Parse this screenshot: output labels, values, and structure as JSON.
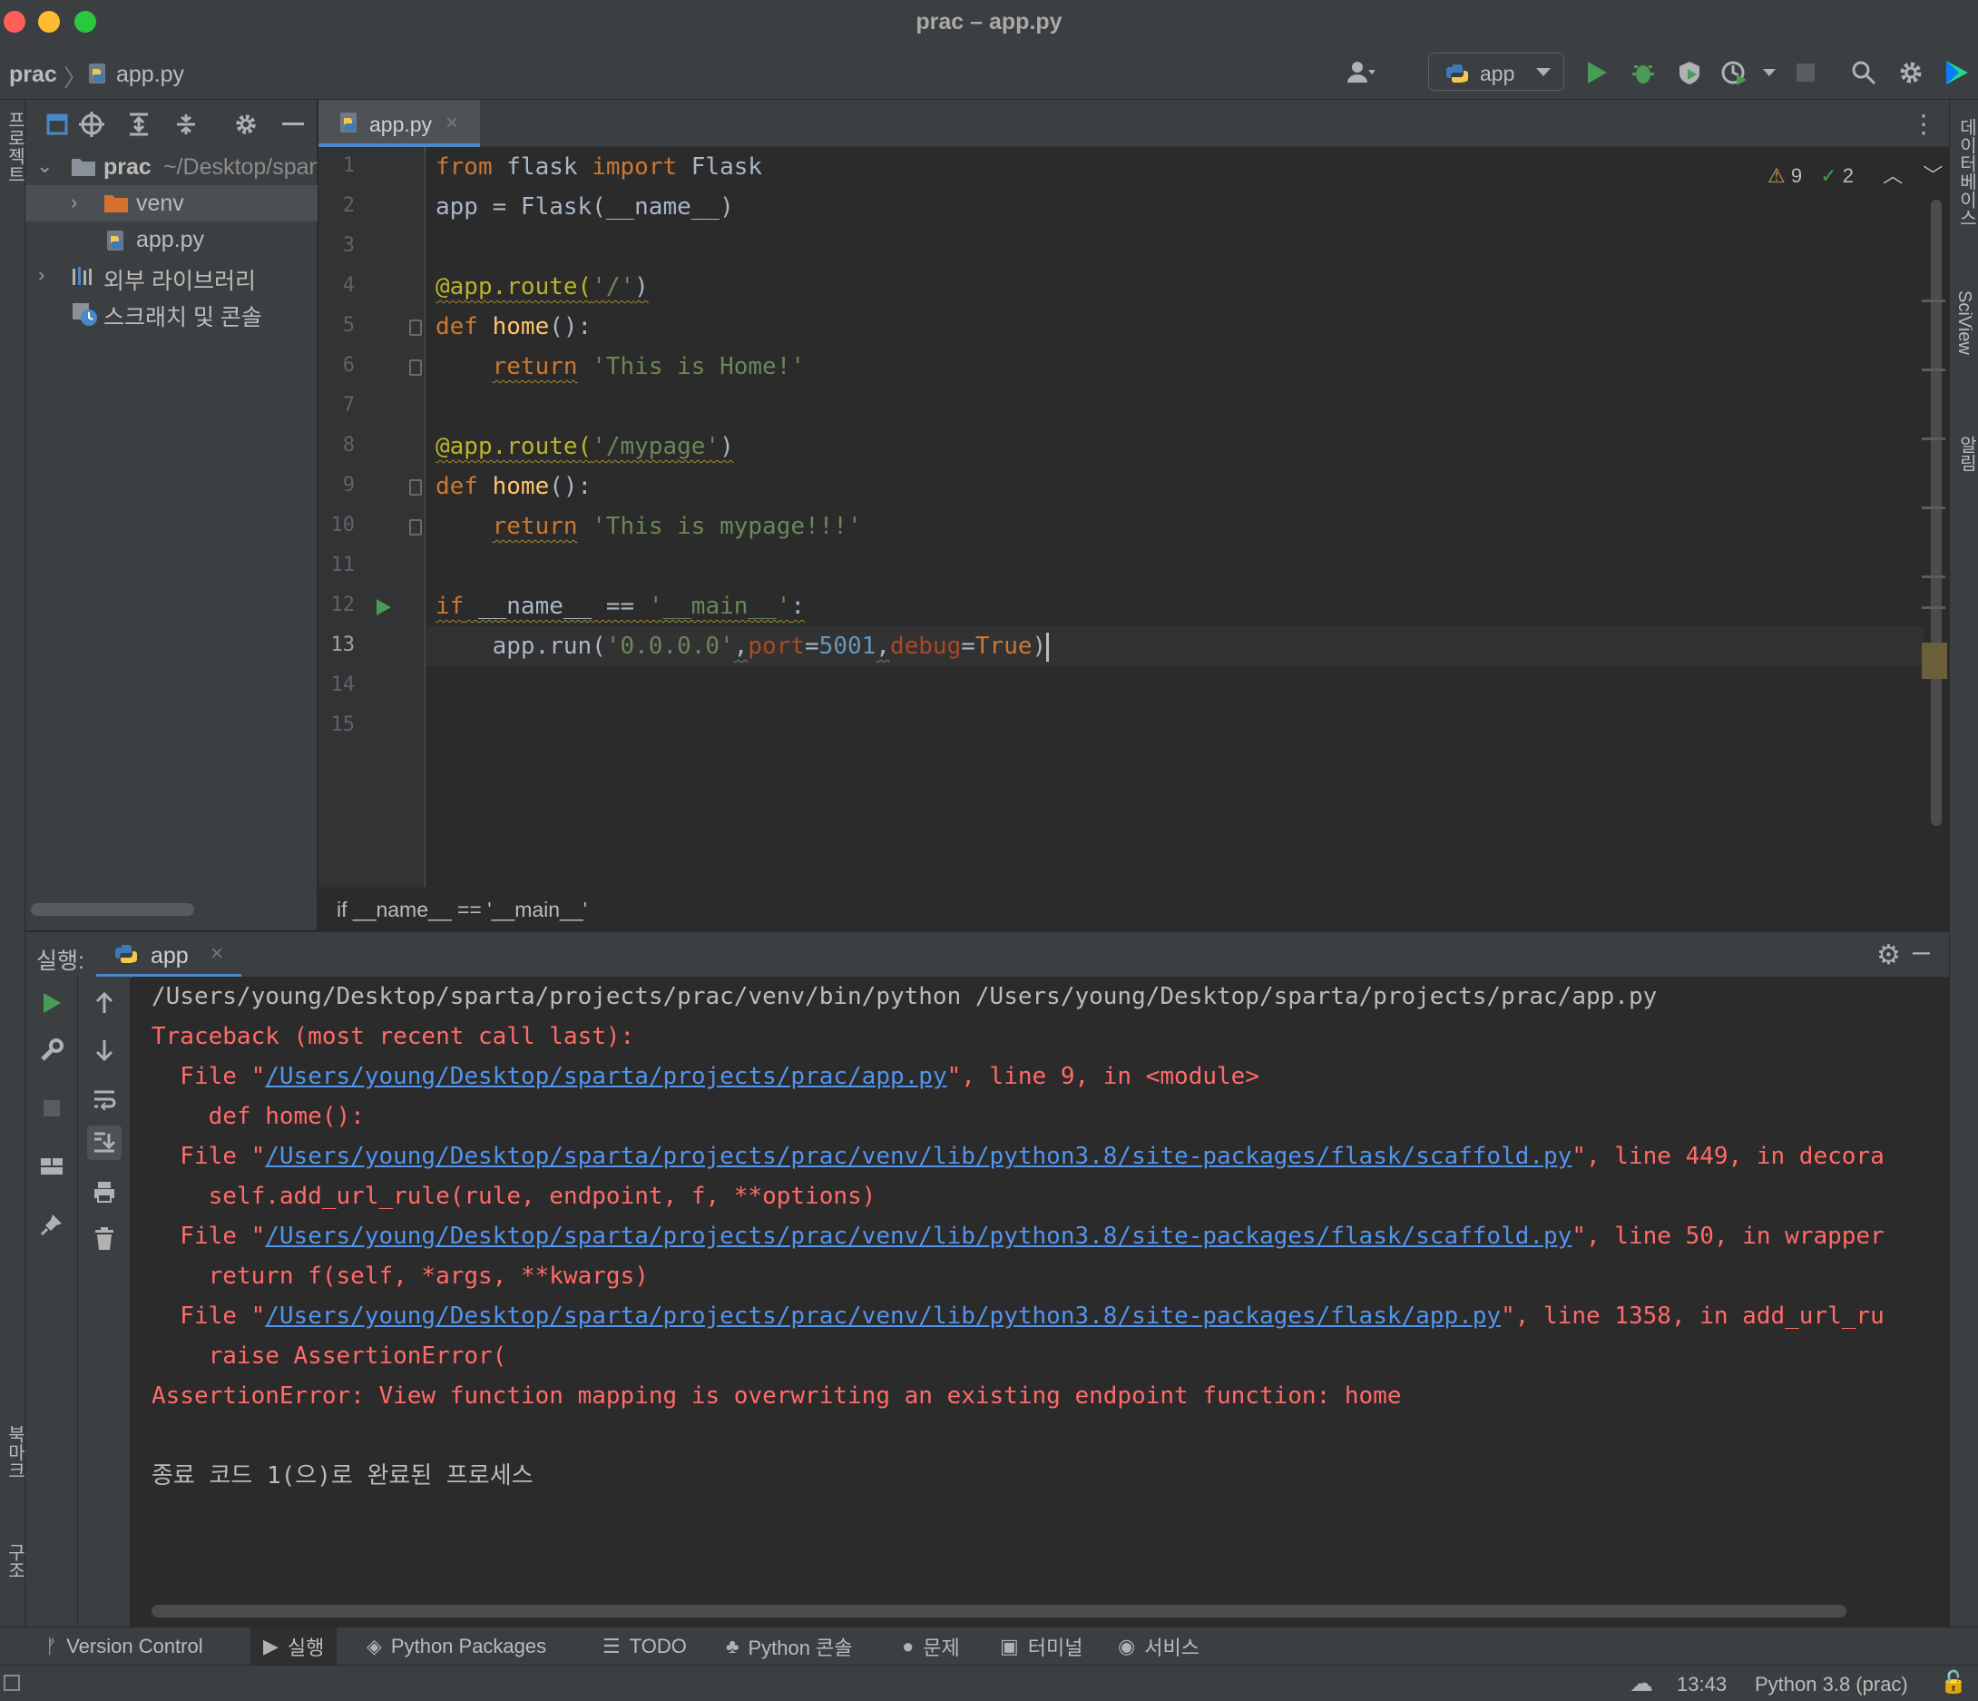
{
  "window": {
    "title": "prac – app.py"
  },
  "navbar": {
    "project": "prac",
    "file": "app.py",
    "run_config": "app"
  },
  "left_stripe": {
    "project_label": "프로젝트",
    "bookmarks_label": "북마크",
    "structure_label": "구조"
  },
  "right_stripe": {
    "database_label": "데이터베이스",
    "sciview_label": "SciView",
    "notifications_label": "알림"
  },
  "project_tree": {
    "root_name": "prac",
    "root_path": "~/Desktop/sparta/projects/prac",
    "items": [
      {
        "label": "venv",
        "type": "folder"
      },
      {
        "label": "app.py",
        "type": "python-file"
      },
      {
        "label": "외부 라이브러리",
        "type": "libraries"
      },
      {
        "label": "스크래치 및 콘솔",
        "type": "scratches"
      }
    ]
  },
  "editor": {
    "tab_label": "app.py",
    "warnings_count": "9",
    "weak_warnings_count": "2",
    "current_line": 13,
    "line_numbers": [
      "1",
      "2",
      "3",
      "4",
      "5",
      "6",
      "7",
      "8",
      "9",
      "10",
      "11",
      "12",
      "13",
      "14",
      "15"
    ],
    "lines": {
      "l1": {
        "a": "from",
        "b": " flask ",
        "c": "import",
        "d": " Flask"
      },
      "l2": {
        "a": "app = Flask(__name__)"
      },
      "l4": {
        "a": "@app.route(",
        "b": "'/'",
        "c": ")"
      },
      "l5": {
        "a": "def",
        "b": " ",
        "c": "home",
        "d": "():"
      },
      "l6": {
        "a": "    ",
        "b": "return",
        "c": " ",
        "d": "'This is Home!'"
      },
      "l8": {
        "a": "@app.route(",
        "b": "'/mypage'",
        "c": ")"
      },
      "l9": {
        "a": "def",
        "b": " ",
        "c": "home",
        "d": "():"
      },
      "l10": {
        "a": "    ",
        "b": "return",
        "c": " ",
        "d": "'This is mypage!!!'"
      },
      "l12": {
        "a": "if",
        "b": " ",
        "c": "__name__",
        "d": " == ",
        "e": "'__main__'",
        "f": ":"
      },
      "l13": {
        "a": "    app.run(",
        "b": "'0.0.0.0'",
        "c": ",",
        "d": "port",
        "e": "=",
        "f": "5001",
        "g": ",",
        "h": "debug",
        "i": "=",
        "j": "True",
        "k": ")"
      }
    },
    "breadcrumb": "if __name__ == '__main__'"
  },
  "run_panel": {
    "title": "실행:",
    "tab_label": "app",
    "console": {
      "cmd": "/Users/young/Desktop/sparta/projects/prac/venv/bin/python /Users/young/Desktop/sparta/projects/prac/app.py",
      "traceback_header": "Traceback (most recent call last):",
      "frames": [
        {
          "prefix": "  File \"",
          "path": "/Users/young/Desktop/sparta/projects/prac/app.py",
          "suffix": "\", line 9, in <module>",
          "code": "    def home():"
        },
        {
          "prefix": "  File \"",
          "path": "/Users/young/Desktop/sparta/projects/prac/venv/lib/python3.8/site-packages/flask/scaffold.py",
          "suffix": "\", line 449, in decora",
          "code": "    self.add_url_rule(rule, endpoint, f, **options)"
        },
        {
          "prefix": "  File \"",
          "path": "/Users/young/Desktop/sparta/projects/prac/venv/lib/python3.8/site-packages/flask/scaffold.py",
          "suffix": "\", line 50, in wrapper",
          "code": "    return f(self, *args, **kwargs)"
        },
        {
          "prefix": "  File \"",
          "path": "/Users/young/Desktop/sparta/projects/prac/venv/lib/python3.8/site-packages/flask/app.py",
          "suffix": "\", line 1358, in add_url_ru",
          "code": "    raise AssertionError("
        }
      ],
      "error": "AssertionError: View function mapping is overwriting an existing endpoint function: home",
      "exit": "종료 코드 1(으)로 완료된 프로세스"
    }
  },
  "tool_windows": [
    {
      "label": "Version Control",
      "icon": "version-control-icon"
    },
    {
      "label": "실행",
      "icon": "run-icon",
      "active": true
    },
    {
      "label": "Python Packages",
      "icon": "packages-icon"
    },
    {
      "label": "TODO",
      "icon": "todo-icon"
    },
    {
      "label": "Python 콘솔",
      "icon": "python-console-icon"
    },
    {
      "label": "문제",
      "icon": "problems-icon"
    },
    {
      "label": "터미널",
      "icon": "terminal-icon"
    },
    {
      "label": "서비스",
      "icon": "services-icon"
    }
  ],
  "status_bar": {
    "time": "13:43",
    "interpreter": "Python 3.8 (prac)"
  },
  "colors": {
    "accent": "#4a88c7",
    "run_green": "#499c54",
    "error_red": "#ff6b68",
    "link_blue": "#5394ec"
  }
}
